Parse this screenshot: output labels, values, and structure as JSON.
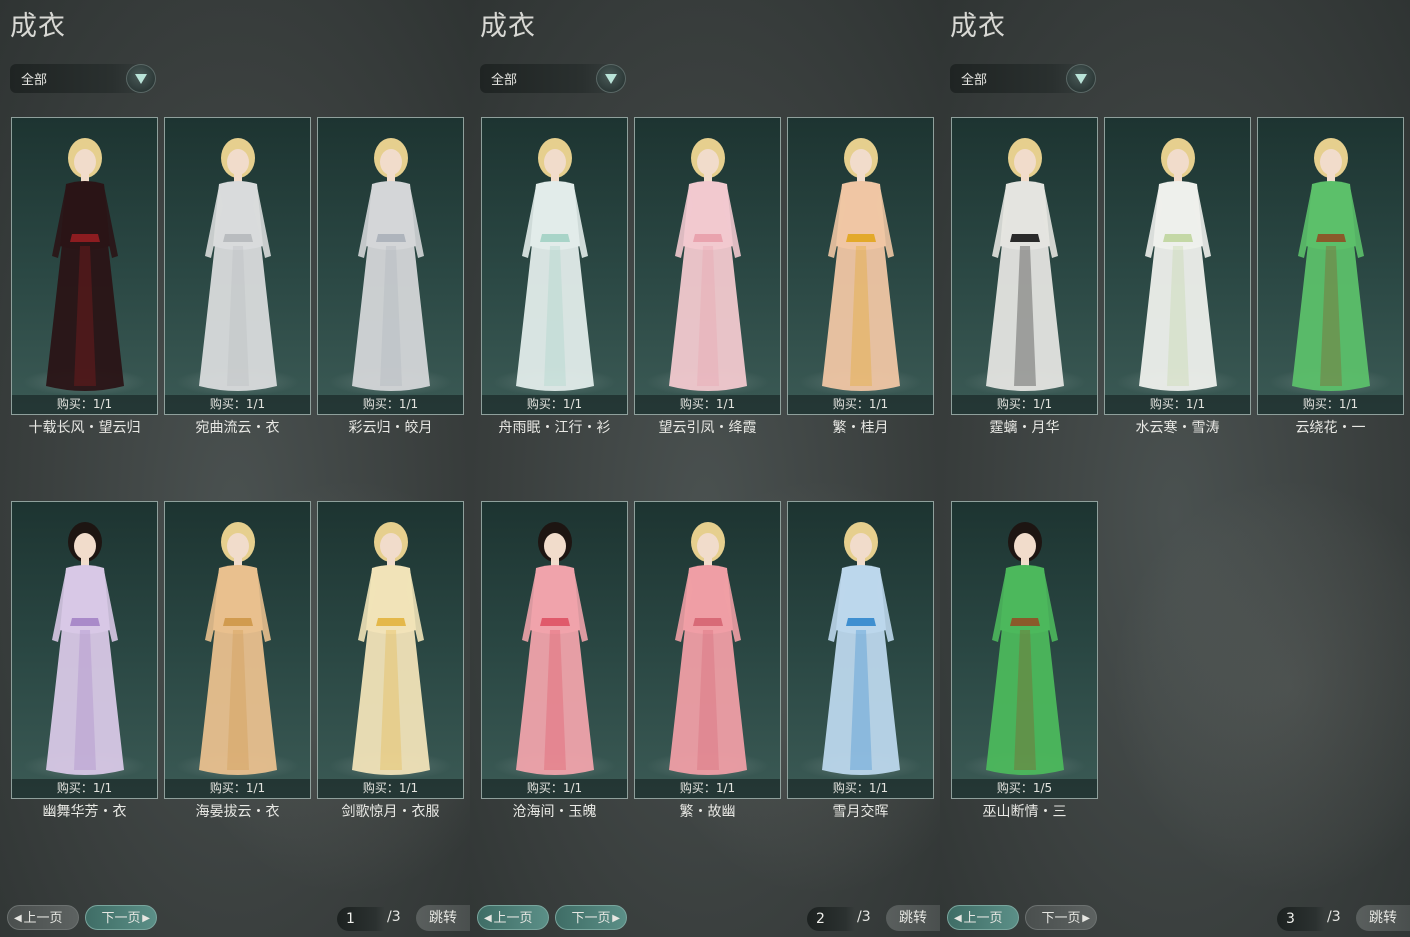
{
  "panels": [
    {
      "title": "成衣",
      "filter": "全部",
      "items": [
        {
          "name": "十载长风・望云归",
          "buy": "购买：1/1",
          "outfit": "#2a1416",
          "accent": "#8c1c20"
        },
        {
          "name": "宛曲流云・衣",
          "buy": "购买：1/1",
          "outfit": "#d9dbdc",
          "accent": "#b9bcbf"
        },
        {
          "name": "彩云归・皎月",
          "buy": "购买：1/1",
          "outfit": "#d4d6d8",
          "accent": "#aeb4bc"
        },
        {
          "name": "幽舞华芳・衣",
          "buy": "购买：1/1",
          "outfit": "#d8c8e6",
          "accent": "#a98ac9"
        },
        {
          "name": "海晏拔云・衣",
          "buy": "购买：1/1",
          "outfit": "#e9c08e",
          "accent": "#d19b4f"
        },
        {
          "name": "剑歌惊月・衣服",
          "buy": "购买：1/1",
          "outfit": "#f1e3b8",
          "accent": "#e4b84a"
        }
      ],
      "prev": "上一页",
      "next": "下一页",
      "page": "1",
      "total": "/3",
      "jump": "跳转",
      "active": "next"
    },
    {
      "title": "成衣",
      "filter": "全部",
      "items": [
        {
          "name": "舟雨眠・江行・衫",
          "buy": "购买：1/1",
          "outfit": "#e2ecea",
          "accent": "#a8d4c8"
        },
        {
          "name": "望云引凤・绛霞",
          "buy": "购买：1/1",
          "outfit": "#f2c9cf",
          "accent": "#e9a3ae"
        },
        {
          "name": "繁・桂月",
          "buy": "购买：1/1",
          "outfit": "#f0c6a4",
          "accent": "#e3a92a"
        },
        {
          "name": "沧海间・玉魄",
          "buy": "购买：1/1",
          "outfit": "#f0a3ab",
          "accent": "#e05a6b"
        },
        {
          "name": "繁・故幽",
          "buy": "购买：1/1",
          "outfit": "#ef9ea5",
          "accent": "#d86a77"
        },
        {
          "name": "雪月交晖",
          "buy": "购买：1/1",
          "outfit": "#bcd7ec",
          "accent": "#3f8fd0"
        }
      ],
      "prev": "上一页",
      "next": "下一页",
      "page": "2",
      "total": "/3",
      "jump": "跳转",
      "active": "both"
    },
    {
      "title": "成衣",
      "filter": "全部",
      "items": [
        {
          "name": "霆螭・月华",
          "buy": "购买：1/1",
          "outfit": "#e4e4e0",
          "accent": "#2a2a2a"
        },
        {
          "name": "水云寒・雪涛",
          "buy": "购买：1/1",
          "outfit": "#eef0ec",
          "accent": "#c4d8a6"
        },
        {
          "name": "云绕花・一",
          "buy": "购买：1/1",
          "outfit": "#5cc06a",
          "accent": "#8a5a2a"
        },
        {
          "name": "巫山断情・三",
          "buy": "购买：1/5",
          "outfit": "#4cb85c",
          "accent": "#8a5a2a"
        }
      ],
      "prev": "上一页",
      "next": "下一页",
      "page": "3",
      "total": "/3",
      "jump": "跳转",
      "active": "prev"
    }
  ]
}
